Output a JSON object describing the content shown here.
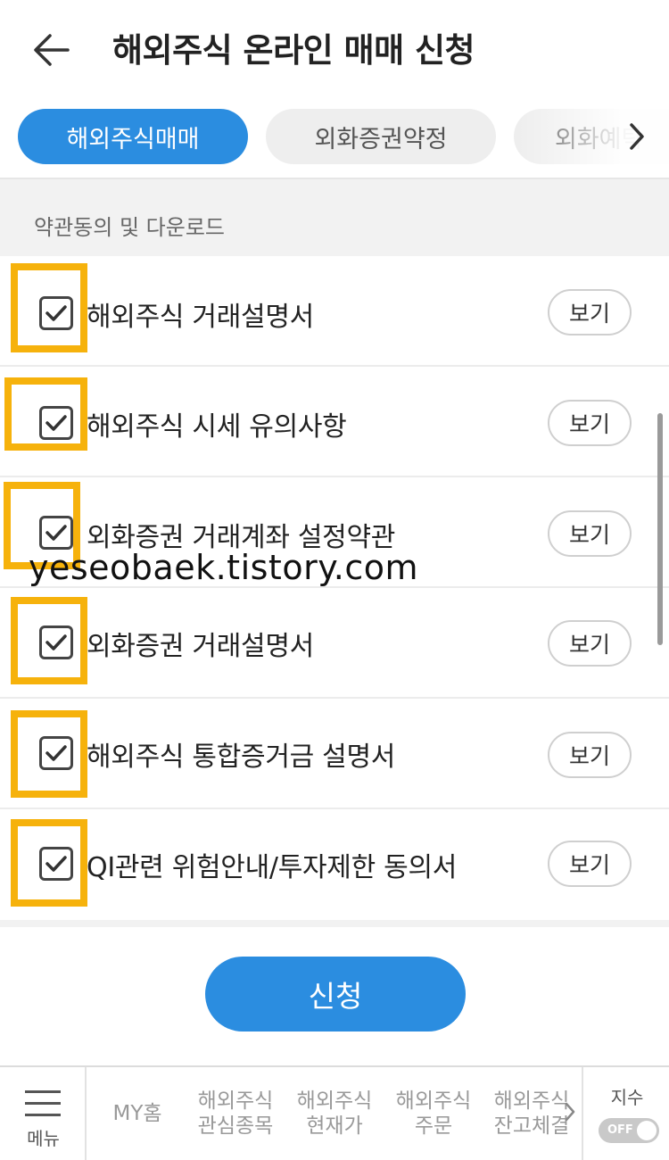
{
  "header": {
    "title": "해외주식 온라인 매매 신청"
  },
  "tabs": [
    {
      "label": "해외주식매매",
      "active": true
    },
    {
      "label": "외화증권약정",
      "active": false
    },
    {
      "label": "외화예탁",
      "active": false
    }
  ],
  "section": {
    "title": "약관동의 및 다운로드"
  },
  "agreements": [
    {
      "label": "해외주식 거래설명서",
      "checked": true,
      "button": "보기"
    },
    {
      "label": "해외주식 시세 유의사항",
      "checked": true,
      "button": "보기"
    },
    {
      "label": "외화증권 거래계좌 설정약관",
      "checked": true,
      "button": "보기"
    },
    {
      "label": "외화증권 거래설명서",
      "checked": true,
      "button": "보기"
    },
    {
      "label": "해외주식 통합증거금 설명서",
      "checked": true,
      "button": "보기"
    },
    {
      "label": "QI관련 위험안내/투자제한 동의서",
      "checked": true,
      "button": "보기"
    }
  ],
  "watermark": "yeseobaek.tistory.com",
  "submit": {
    "label": "신청"
  },
  "bottom_nav": {
    "menu_label": "메뉴",
    "items": [
      {
        "label": "MY홈"
      },
      {
        "label": "해외주식\n관심종목"
      },
      {
        "label": "해외주식\n현재가"
      },
      {
        "label": "해외주식\n주문"
      },
      {
        "label": "해외주식\n잔고체결"
      }
    ],
    "index_label": "지수",
    "toggle_label": "OFF"
  },
  "colors": {
    "accent": "#2b8de0",
    "highlight": "#f6b20c"
  }
}
